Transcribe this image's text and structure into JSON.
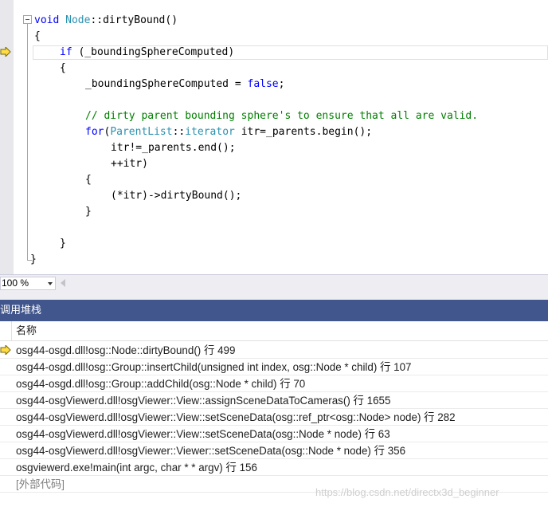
{
  "editor": {
    "lines": [
      {
        "id": "l1",
        "segments": [
          {
            "c": "kw",
            "t": "void"
          },
          {
            "c": "",
            "t": " "
          },
          {
            "c": "typ",
            "t": "Node"
          },
          {
            "c": "",
            "t": "::dirtyBound()"
          }
        ]
      },
      {
        "id": "l2",
        "segments": [
          {
            "c": "",
            "t": "{"
          }
        ]
      },
      {
        "id": "l3",
        "segments": [
          {
            "c": "kw",
            "t": "if"
          },
          {
            "c": "",
            "t": " (_boundingSphereComputed)"
          }
        ]
      },
      {
        "id": "l4",
        "segments": [
          {
            "c": "",
            "t": "{"
          }
        ]
      },
      {
        "id": "l5",
        "segments": [
          {
            "c": "",
            "t": "_boundingSphereComputed = "
          },
          {
            "c": "kw",
            "t": "false"
          },
          {
            "c": "",
            "t": ";"
          }
        ]
      },
      {
        "id": "l6",
        "segments": []
      },
      {
        "id": "l7",
        "segments": [
          {
            "c": "cmt",
            "t": "// dirty parent bounding sphere's to ensure that all are valid."
          }
        ]
      },
      {
        "id": "l8",
        "segments": [
          {
            "c": "kw",
            "t": "for"
          },
          {
            "c": "",
            "t": "("
          },
          {
            "c": "typ",
            "t": "ParentList"
          },
          {
            "c": "",
            "t": "::"
          },
          {
            "c": "typ",
            "t": "iterator"
          },
          {
            "c": "",
            "t": " itr=_parents.begin();"
          }
        ]
      },
      {
        "id": "l9",
        "segments": [
          {
            "c": "",
            "t": "itr!=_parents.end();"
          }
        ]
      },
      {
        "id": "l10",
        "segments": [
          {
            "c": "",
            "t": "++itr)"
          }
        ]
      },
      {
        "id": "l11",
        "segments": [
          {
            "c": "",
            "t": "{"
          }
        ]
      },
      {
        "id": "l12",
        "segments": [
          {
            "c": "",
            "t": "(*itr)->dirtyBound();"
          }
        ]
      },
      {
        "id": "l13",
        "segments": [
          {
            "c": "",
            "t": "}"
          }
        ]
      },
      {
        "id": "l14",
        "segments": []
      },
      {
        "id": "l15",
        "segments": [
          {
            "c": "",
            "t": "}"
          }
        ]
      },
      {
        "id": "l16",
        "segments": [
          {
            "c": "",
            "t": "}"
          }
        ]
      }
    ]
  },
  "zoom": {
    "value": "100 %"
  },
  "callstack": {
    "title": "调用堆栈",
    "column_name": "名称",
    "frames": [
      {
        "text": "osg44-osgd.dll!osg::Node::dirtyBound() 行 499",
        "current": true,
        "external": false
      },
      {
        "text": "osg44-osgd.dll!osg::Group::insertChild(unsigned int index, osg::Node * child) 行 107",
        "current": false,
        "external": false
      },
      {
        "text": "osg44-osgd.dll!osg::Group::addChild(osg::Node * child) 行 70",
        "current": false,
        "external": false
      },
      {
        "text": "osg44-osgViewerd.dll!osgViewer::View::assignSceneDataToCameras() 行 1655",
        "current": false,
        "external": false
      },
      {
        "text": "osg44-osgViewerd.dll!osgViewer::View::setSceneData(osg::ref_ptr<osg::Node> node) 行 282",
        "current": false,
        "external": false
      },
      {
        "text": "osg44-osgViewerd.dll!osgViewer::View::setSceneData(osg::Node * node) 行 63",
        "current": false,
        "external": false
      },
      {
        "text": "osg44-osgViewerd.dll!osgViewer::Viewer::setSceneData(osg::Node * node) 行 356",
        "current": false,
        "external": false
      },
      {
        "text": "osgviewerd.exe!main(int argc, char * * argv) 行 156",
        "current": false,
        "external": false
      },
      {
        "text": "[外部代码]",
        "current": false,
        "external": true
      }
    ]
  },
  "watermark": "https://blog.csdn.net/directx3d_beginner",
  "colors": {
    "keyword": "#0000ff",
    "type": "#2b91af",
    "comment": "#008000",
    "panel_header": "#40568d",
    "arrow_fill": "#ffdb47",
    "arrow_stroke": "#7a6a00"
  },
  "icons": {
    "execution_pointer": "yellow-right-arrow-icon",
    "fold_toggle": "collapse-minus-icon"
  }
}
